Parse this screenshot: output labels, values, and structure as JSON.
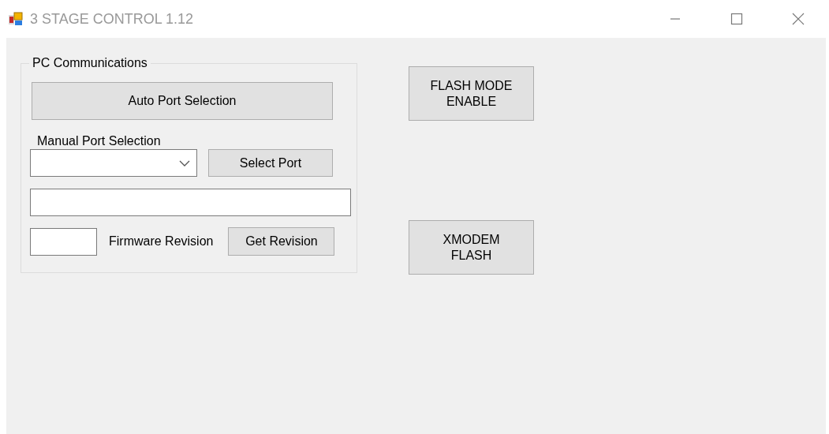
{
  "window": {
    "title": "3 STAGE CONTROL 1.12"
  },
  "pc_communications": {
    "title": "PC Communications",
    "auto_port_button": "Auto Port Selection",
    "manual_port_label": "Manual Port Selection",
    "select_port_button": "Select Port",
    "firmware_label": "Firmware Revision",
    "get_revision_button": "Get Revision"
  },
  "flash_buttons": [
    {
      "label": "FLASH MODE\nENABLE"
    },
    {
      "label": "XMODEM\nFLASH"
    }
  ]
}
